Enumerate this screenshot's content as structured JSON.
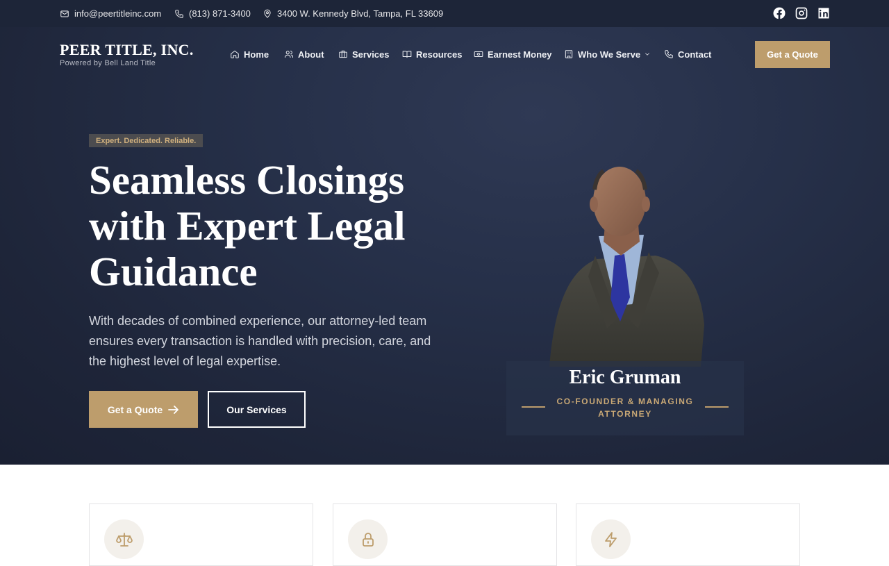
{
  "topbar": {
    "email": "info@peertitleinc.com",
    "phone": "(813) 871-3400",
    "address": "3400 W. Kennedy Blvd, Tampa, FL 33609",
    "social": [
      "facebook-icon",
      "instagram-icon",
      "linkedin-icon"
    ]
  },
  "brand": {
    "name": "PEER TITLE, INC.",
    "tagline": "Powered by Bell Land Title"
  },
  "nav": {
    "items": [
      {
        "label": "Home",
        "icon": "home-icon"
      },
      {
        "label": "About",
        "icon": "users-icon"
      },
      {
        "label": "Services",
        "icon": "briefcase-icon"
      },
      {
        "label": "Resources",
        "icon": "book-icon"
      },
      {
        "label": "Earnest Money",
        "icon": "money-icon"
      },
      {
        "label": "Who We Serve",
        "icon": "building-icon"
      },
      {
        "label": "Contact",
        "icon": "phone-icon"
      }
    ],
    "cta": "Get a Quote"
  },
  "hero": {
    "badge": "Expert. Dedicated. Reliable.",
    "headline": "Seamless Closings with Expert Legal Guidance",
    "lead": "With decades of combined experience, our attorney-led team ensures every transaction is handled with precision, care, and the highest level of legal expertise.",
    "primary_button": "Get a Quote",
    "secondary_button": "Our Services",
    "person": {
      "name": "Eric Gruman",
      "role": "CO-FOUNDER & MANAGING ATTORNEY"
    }
  },
  "features": {
    "icons": [
      "scales-icon",
      "lock-icon",
      "lightning-icon"
    ]
  },
  "colors": {
    "accent": "#bd9d6c",
    "navy": "#1e2539",
    "topbar": "#1d2538"
  }
}
